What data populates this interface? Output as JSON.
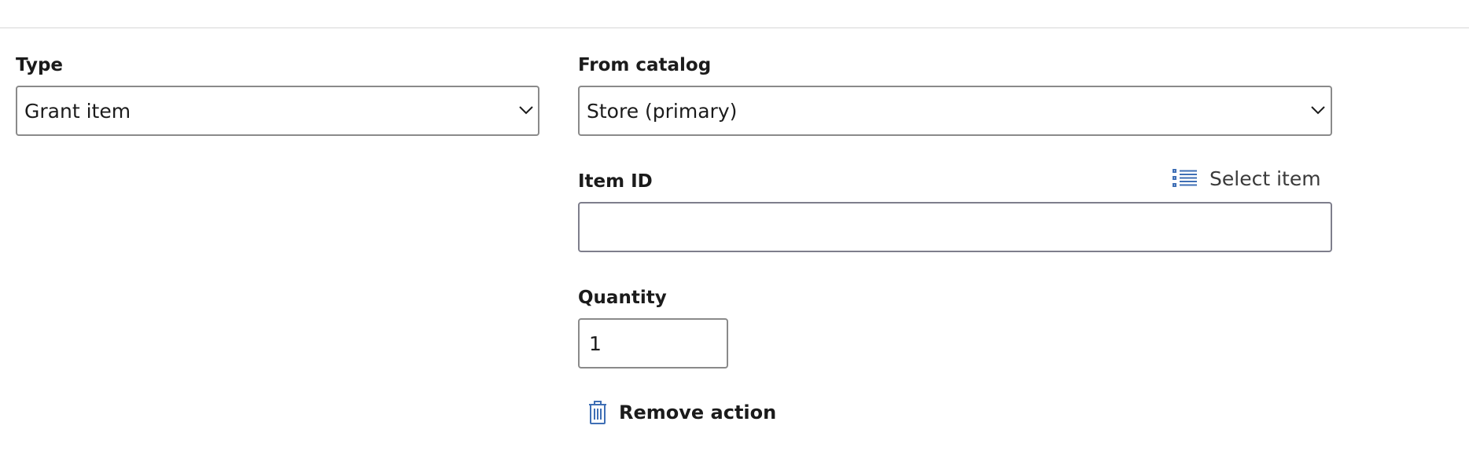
{
  "type_field": {
    "label": "Type",
    "value": "Grant item"
  },
  "catalog_field": {
    "label": "From catalog",
    "value": "Store (primary)"
  },
  "item_id_field": {
    "label": "Item ID",
    "value": "",
    "select_link_label": "Select item"
  },
  "quantity_field": {
    "label": "Quantity",
    "value": "1"
  },
  "remove_action": {
    "label": "Remove action"
  },
  "colors": {
    "accent_icon": "#3f6fb5",
    "text": "#1b1b1b",
    "border": "#8a8a8a",
    "divider": "#d6d6d6"
  },
  "icons": {
    "select_item": "list-icon",
    "remove_action": "trash-icon",
    "dropdown": "chevron-down-icon"
  }
}
